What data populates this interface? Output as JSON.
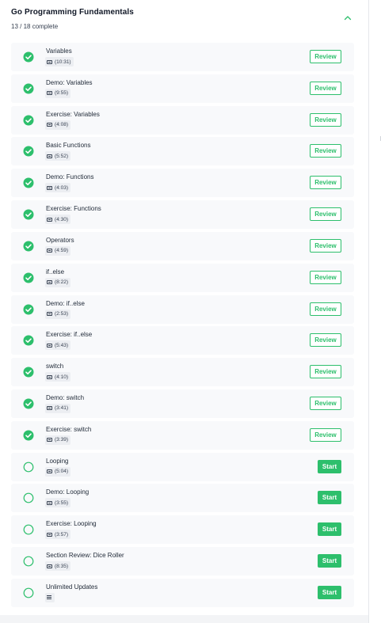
{
  "section": {
    "title": "Go Programming Fundamentals",
    "progress": "13 / 18 complete",
    "accent": "#2dbf6c"
  },
  "lessons": [
    {
      "title": "Variables",
      "duration": "(10:31)",
      "complete": true,
      "action": "Review",
      "media": "video"
    },
    {
      "title": "Demo: Variables",
      "duration": "(9:55)",
      "complete": true,
      "action": "Review",
      "media": "video"
    },
    {
      "title": "Exercise: Variables",
      "duration": "(4:08)",
      "complete": true,
      "action": "Review",
      "media": "video"
    },
    {
      "title": "Basic Functions",
      "duration": "(5:52)",
      "complete": true,
      "action": "Review",
      "media": "video"
    },
    {
      "title": "Demo: Functions",
      "duration": "(4:03)",
      "complete": true,
      "action": "Review",
      "media": "video"
    },
    {
      "title": "Exercise: Functions",
      "duration": "(4:30)",
      "complete": true,
      "action": "Review",
      "media": "video"
    },
    {
      "title": "Operators",
      "duration": "(4:59)",
      "complete": true,
      "action": "Review",
      "media": "video"
    },
    {
      "title": "if..else",
      "duration": "(8:22)",
      "complete": true,
      "action": "Review",
      "media": "video"
    },
    {
      "title": "Demo: if..else",
      "duration": "(2:53)",
      "complete": true,
      "action": "Review",
      "media": "video"
    },
    {
      "title": "Exercise: if..else",
      "duration": "(5:43)",
      "complete": true,
      "action": "Review",
      "media": "video"
    },
    {
      "title": "switch",
      "duration": "(4:10)",
      "complete": true,
      "action": "Review",
      "media": "video"
    },
    {
      "title": "Demo: switch",
      "duration": "(3:41)",
      "complete": true,
      "action": "Review",
      "media": "video"
    },
    {
      "title": "Exercise: switch",
      "duration": "(3:39)",
      "complete": true,
      "action": "Review",
      "media": "video"
    },
    {
      "title": "Looping",
      "duration": "(5:04)",
      "complete": false,
      "action": "Start",
      "media": "video"
    },
    {
      "title": "Demo: Looping",
      "duration": "(3:55)",
      "complete": false,
      "action": "Start",
      "media": "video"
    },
    {
      "title": "Exercise: Looping",
      "duration": "(3:57)",
      "complete": false,
      "action": "Start",
      "media": "video"
    },
    {
      "title": "Section Review: Dice Roller",
      "duration": "(8:35)",
      "complete": false,
      "action": "Start",
      "media": "video"
    },
    {
      "title": "Unlimited Updates",
      "duration": "",
      "complete": false,
      "action": "Start",
      "media": "text"
    }
  ]
}
